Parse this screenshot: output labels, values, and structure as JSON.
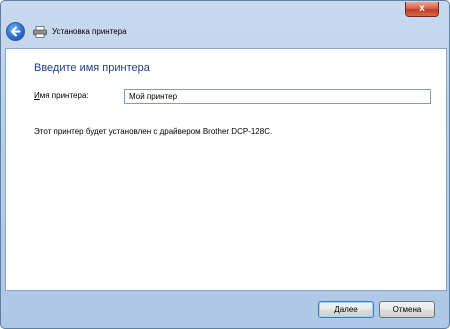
{
  "window": {
    "close_label": "x"
  },
  "nav": {
    "title": "Установка принтера"
  },
  "main": {
    "heading": "Введите имя принтера",
    "field_label_first": "И",
    "field_label_rest": "мя принтера:",
    "printer_name_value": "Мой принтер",
    "info_text": "Этот принтер будет установлен с драйвером Brother DCP-128C."
  },
  "footer": {
    "next_label_first": "Д",
    "next_label_rest": "алее",
    "cancel_label": "Отмена"
  },
  "icons": {
    "back": "back-arrow-icon",
    "printer": "printer-icon",
    "close": "close-icon"
  }
}
